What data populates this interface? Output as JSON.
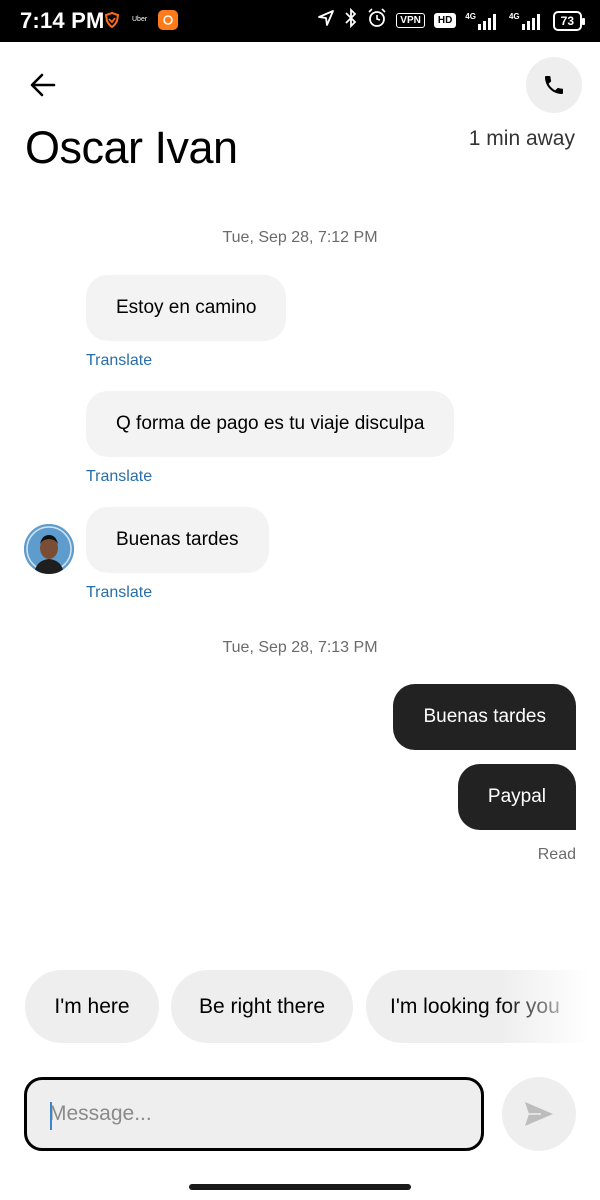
{
  "status_bar": {
    "time": "7:14 PM",
    "app_label": "Uber",
    "vpn": "VPN",
    "hd": "HD",
    "network_1": "4G",
    "network_2": "4G",
    "battery": "73"
  },
  "header": {
    "back_icon": "arrow-left-icon",
    "call_icon": "phone-icon",
    "contact_name": "Oscar Ivan",
    "eta": "1 min away"
  },
  "messages": {
    "date_1": "Tue, Sep 28, 7:12 PM",
    "incoming": [
      {
        "text": "Estoy en camino",
        "translate": "Translate"
      },
      {
        "text": "Q forma de pago es tu viaje disculpa",
        "translate": "Translate"
      },
      {
        "text": "Buenas tardes",
        "translate": "Translate"
      }
    ],
    "date_2": "Tue, Sep 28, 7:13 PM",
    "outgoing": [
      {
        "text": "Buenas tardes"
      },
      {
        "text": "Paypal"
      }
    ],
    "read_status": "Read"
  },
  "quick_replies": [
    "I'm here",
    "Be right there",
    "I'm looking for you"
  ],
  "composer": {
    "placeholder": "Message...",
    "value": "",
    "send_icon": "send-icon"
  },
  "colors": {
    "outgoing_bubble": "#222222",
    "incoming_bubble": "#f3f3f3",
    "translate_link": "#2a6ea8"
  }
}
